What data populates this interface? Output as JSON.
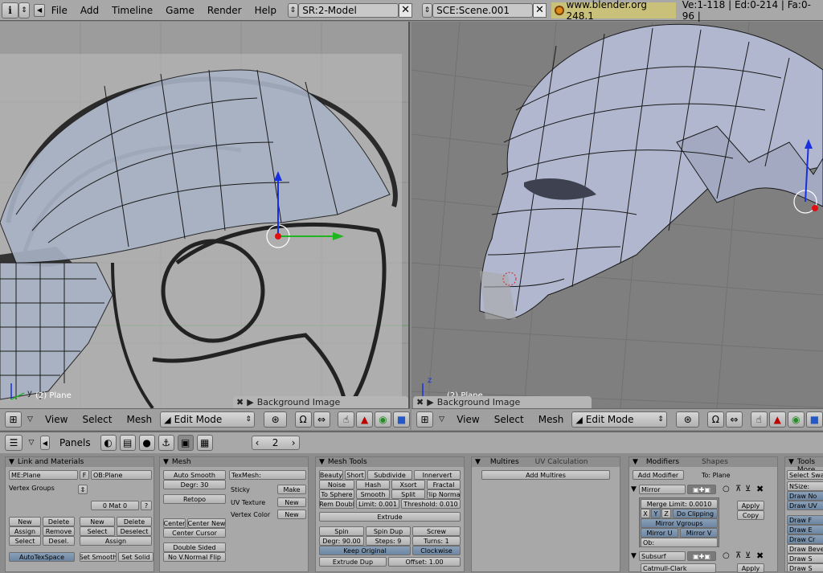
{
  "topbar": {
    "info_icon": "info-icon",
    "menus": [
      "File",
      "Add",
      "Timeline",
      "Game",
      "Render",
      "Help"
    ],
    "screen_field": "SR:2-Model",
    "scene_field": "SCE:Scene.001",
    "version": "www.blender.org 248.1",
    "stats": "Ve:1-118 | Ed:0-214 | Fa:0-96 |"
  },
  "left_view": {
    "object_label": "(2) Plane",
    "axis_y": "y",
    "axis_z": "z",
    "bg_panel": "Background Image",
    "header": {
      "view": "View",
      "select": "Select",
      "mesh": "Mesh",
      "mode": "Edit Mode"
    }
  },
  "right_view": {
    "object_label": "(2) Plane",
    "axis_z": "z",
    "bg_panel": "Background Image",
    "header": {
      "view": "View",
      "select": "Select",
      "mesh": "Mesh",
      "mode": "Edit Mode"
    }
  },
  "buttons_window": {
    "panels_label": "Panels",
    "frame": "2"
  },
  "link_materials": {
    "title": "Link and Materials",
    "me_field": "ME:Plane",
    "f_label": "F",
    "ob_field": "OB:Plane",
    "vertex_groups": "Vertex Groups",
    "mat_field": "0 Mat 0",
    "question": "?",
    "new": "New",
    "delete": "Delete",
    "assign": "Assign",
    "remove": "Remove",
    "select": "Select",
    "desel": "Desel.",
    "new2": "New",
    "delete2": "Delete",
    "select2": "Select",
    "deselect2": "Deselect",
    "assign2": "Assign",
    "autotexspace": "AutoTexSpace",
    "set_smooth": "Set Smooth",
    "set_solid": "Set Solid"
  },
  "mesh": {
    "title": "Mesh",
    "auto_smooth": "Auto Smooth",
    "degr": "Degr: 30",
    "retopo": "Retopo",
    "center": "Center",
    "center_new": "Center New",
    "center_cursor": "Center Cursor",
    "double_sided": "Double Sided",
    "no_vnormal_flip": "No V.Normal Flip",
    "texmesh": "TexMesh:",
    "sticky": "Sticky",
    "make": "Make",
    "uv_texture": "UV Texture",
    "new_uv": "New",
    "vertex_color": "Vertex Color",
    "new_vc": "New"
  },
  "mesh_tools": {
    "title": "Mesh Tools",
    "row1": [
      "Beauty",
      "Short",
      "Subdivide",
      "Innervert"
    ],
    "row2": [
      "Noise",
      "Hash",
      "Xsort",
      "Fractal"
    ],
    "row3": [
      "To Sphere",
      "Smooth",
      "Split",
      "Flip Normal"
    ],
    "rem_doubl": "Rem Doubl",
    "limit": "Limit: 0.001",
    "threshold": "Threshold: 0.010",
    "extrude": "Extrude",
    "spin": "Spin",
    "spin_dup": "Spin Dup",
    "screw": "Screw",
    "degr": "Degr: 90.00",
    "steps": "Steps: 9",
    "turns": "Turns: 1",
    "keep_original": "Keep Original",
    "clockwise": "Clockwise",
    "extrude_dup": "Extrude Dup",
    "offset": "Offset: 1.00"
  },
  "multires": {
    "tab1": "Multires",
    "tab2": "UV Calculation",
    "add_multires": "Add Multires"
  },
  "modifiers": {
    "tab1": "Modifiers",
    "tab2": "Shapes",
    "add_modifier": "Add Modifier",
    "to_plane": "To: Plane",
    "mirror_name": "Mirror",
    "merge_limit": "Merge Limit: 0.0010",
    "x": "X",
    "y": "Y",
    "z": "Z",
    "do_clipping": "Do Clipping",
    "mirror_vgroups": "Mirror Vgroups",
    "mirror_u": "Mirror U",
    "mirror_v": "Mirror V",
    "ob": "Ob:",
    "apply": "Apply",
    "copy": "Copy",
    "subsurf_name": "Subsurf",
    "catmull": "Catmull-Clark",
    "apply2": "Apply"
  },
  "mesh_tools_more": {
    "title": "Mesh Tools More",
    "items": [
      "Select Swap",
      "NSize:",
      "Draw No",
      "Draw UV",
      "Draw F",
      "Draw E",
      "Draw Cr",
      "Draw Beve",
      "Draw S",
      "Draw S"
    ]
  }
}
